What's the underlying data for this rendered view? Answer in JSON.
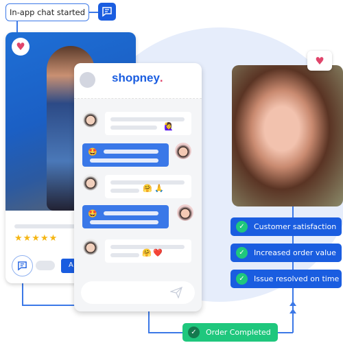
{
  "flow": {
    "start_label": "In-app chat started",
    "order_label": "Order Completed",
    "outcomes": [
      "Customer satisfaction",
      "Increased order value",
      "Issue resolved on time"
    ]
  },
  "product_card": {
    "rating": "★★★★★",
    "rating_value": 5,
    "button_label": "A",
    "heart_icon": "heart-icon"
  },
  "chat": {
    "brand": "shopney",
    "brand_dot": ".",
    "emojis": [
      "🙋‍♀️",
      "🤩",
      "🤗",
      "🙏",
      "🤩",
      "🤗",
      "❤️"
    ]
  },
  "colors": {
    "accent": "#1a5de0",
    "success": "#1fc77d",
    "heart": "#e0456b",
    "background_circle": "#e6edfb"
  }
}
